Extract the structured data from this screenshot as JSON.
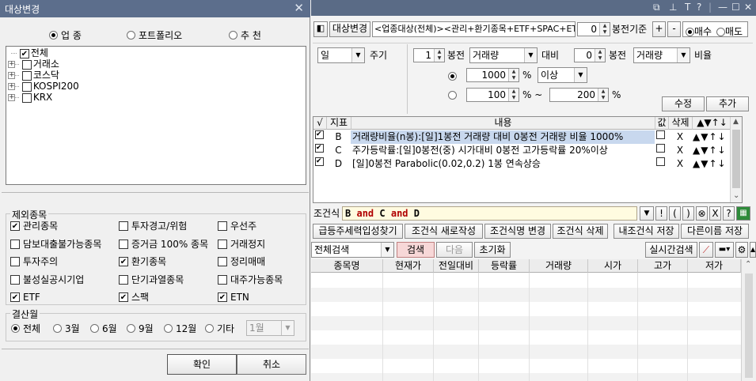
{
  "left": {
    "title": "대상변경",
    "radios": [
      {
        "label": "업 종",
        "selected": true
      },
      {
        "label": "포트폴리오",
        "selected": false
      },
      {
        "label": "추 천",
        "selected": false
      }
    ],
    "tree": [
      {
        "label": "전체",
        "checked": true,
        "expandable": false
      },
      {
        "label": "거래소",
        "checked": false,
        "expandable": true
      },
      {
        "label": "코스닥",
        "checked": false,
        "expandable": true
      },
      {
        "label": "KOSPI200",
        "checked": false,
        "expandable": true
      },
      {
        "label": "KRX",
        "checked": false,
        "expandable": true
      }
    ],
    "exclude_title": "제외종목",
    "exclude": [
      {
        "label": "관리종목",
        "checked": true
      },
      {
        "label": "투자경고/위험",
        "checked": false
      },
      {
        "label": "우선주",
        "checked": false
      },
      {
        "label": "담보대출불가능종목",
        "checked": false
      },
      {
        "label": "증거금 100% 종목",
        "checked": false
      },
      {
        "label": "거래정지",
        "checked": false
      },
      {
        "label": "투자주의",
        "checked": false
      },
      {
        "label": "환기종목",
        "checked": true
      },
      {
        "label": "정리매매",
        "checked": false
      },
      {
        "label": "불성실공시기업",
        "checked": false
      },
      {
        "label": "단기과열종목",
        "checked": false
      },
      {
        "label": "대주가능종목",
        "checked": false
      },
      {
        "label": "ETF",
        "checked": true
      },
      {
        "label": "스팩",
        "checked": true
      },
      {
        "label": "ETN",
        "checked": true
      }
    ],
    "settle_title": "결산월",
    "settle": [
      {
        "label": "전체",
        "selected": true
      },
      {
        "label": "3월",
        "selected": false
      },
      {
        "label": "6월",
        "selected": false
      },
      {
        "label": "9월",
        "selected": false
      },
      {
        "label": "12월",
        "selected": false
      },
      {
        "label": "기타",
        "selected": false
      }
    ],
    "settle_select": "1월",
    "ok": "확인",
    "cancel": "취소"
  },
  "right": {
    "top_icons": [
      "window-icon",
      "pin-icon",
      "font-icon",
      "help-icon",
      "minimize-icon",
      "maximize-icon",
      "close-icon"
    ],
    "target_button": "대상변경",
    "target_text": "<업종대상(전체)><관리+환기종목+ETF+SPAC+ETN",
    "bar_offset": "0",
    "bar_basis": "봉전기준",
    "plus": "+",
    "minus": "-",
    "buy": "매수",
    "sell": "매도",
    "period_value": "일",
    "period_label": "주기",
    "n1": "1",
    "bong1": "봉전",
    "field1": "거래량",
    "compare": "대비",
    "n2": "0",
    "bong2": "봉전",
    "field2": "거래량",
    "ratio": "비율",
    "val1": "1000",
    "pct1": "%",
    "above": "이상",
    "val2": "100",
    "pct_tilde": "% ~",
    "val3": "200",
    "pct3": "%",
    "edit": "수정",
    "add": "추가",
    "cond_headers": [
      "√",
      "지표",
      "내용",
      "값",
      "삭제",
      "▲▼↑↓"
    ],
    "conditions": [
      {
        "checked": true,
        "id": "B",
        "content": "거래량비율(n봉):[일]1봉전 거래량 대비 0봉전 거래량 비율 1000%",
        "value_checked": false,
        "del": "X",
        "arrows": "▲▼↑↓",
        "selected": true
      },
      {
        "checked": true,
        "id": "C",
        "content": "주가등락률:[일]0봉전(중) 시가대비 0봉전 고가등락률 20%이상",
        "value_checked": false,
        "del": "X",
        "arrows": "▲▼↑↓",
        "selected": false
      },
      {
        "checked": true,
        "id": "D",
        "content": "[일]0봉전 Parabolic(0.02,0.2) 1봉 연속상승",
        "value_checked": false,
        "del": "X",
        "arrows": "▲▼↑↓",
        "selected": false
      }
    ],
    "expr_label": "조건식",
    "expr": {
      "a": "B",
      "op1": "and",
      "b": "C",
      "op2": "and",
      "c": "D"
    },
    "expr_tools": [
      "!",
      "(",
      ")",
      "⊗",
      "X",
      "?"
    ],
    "action_buttons": [
      "급등주세력입성찾기",
      "조건식 새로작성",
      "조건식명 변경",
      "조건식 삭제",
      "내조건식 저장",
      "다른이름 저장"
    ],
    "search_scope": "전체검색",
    "search": "검색",
    "next": "다음",
    "reset": "초기화",
    "realtime": "실시간검색",
    "result_headers": [
      "종목명",
      "현재가",
      "전일대비",
      "등락률",
      "거래량",
      "시가",
      "고가",
      "저가"
    ]
  }
}
